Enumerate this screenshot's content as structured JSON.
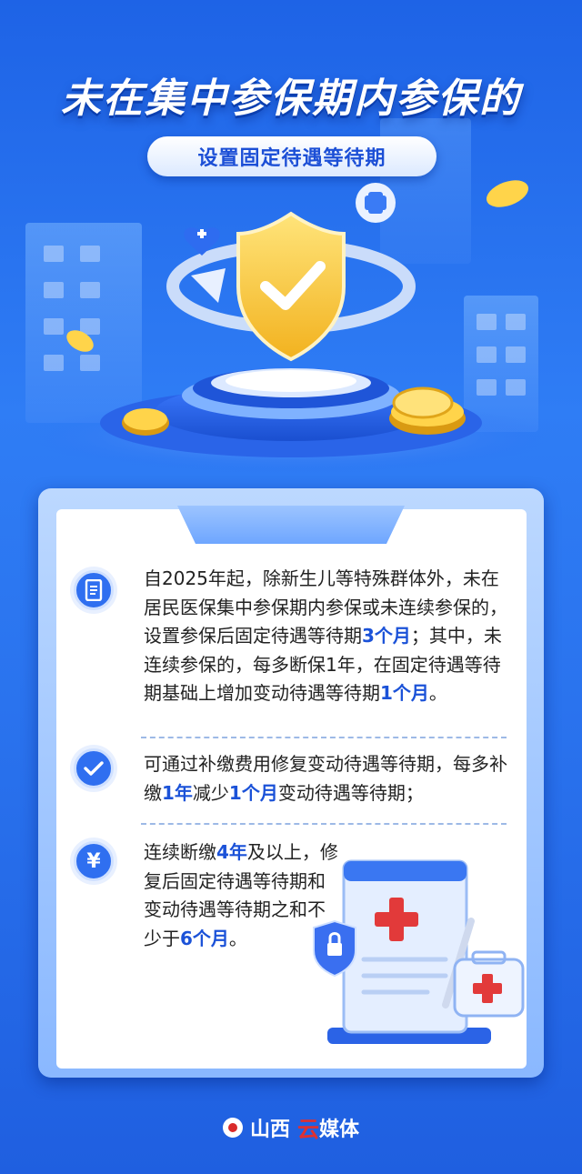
{
  "header": {
    "title": "未在集中参保期内参保的",
    "subtitle": "设置固定待遇等待期"
  },
  "items": [
    {
      "icon": "document-icon",
      "parts": [
        {
          "t": "自2025年起，除新生儿等特殊群体外，未在居民医保集中参保期内参保或未连续参保的，设置参保后固定待遇等待期",
          "hl": false
        },
        {
          "t": "3个月",
          "hl": true
        },
        {
          "t": "；其中，未连续参保的，每多断保1年，在固定待遇等待期基础上增加变动待遇等待期",
          "hl": false
        },
        {
          "t": "1个月",
          "hl": true
        },
        {
          "t": "。",
          "hl": false
        }
      ]
    },
    {
      "icon": "check-circle-icon",
      "parts": [
        {
          "t": "可通过补缴费用修复变动待遇等待期，每多补缴",
          "hl": false
        },
        {
          "t": "1年",
          "hl": true
        },
        {
          "t": "减少",
          "hl": false
        },
        {
          "t": "1个月",
          "hl": true
        },
        {
          "t": "变动待遇等待期；",
          "hl": false
        }
      ]
    },
    {
      "icon": "yen-icon",
      "parts": [
        {
          "t": "连续断缴",
          "hl": false
        },
        {
          "t": "4年",
          "hl": true
        },
        {
          "t": "及以上，修复后固定待遇等待期和变动待遇等待期之和不少于",
          "hl": false
        },
        {
          "t": "6个月",
          "hl": true
        },
        {
          "t": "。",
          "hl": false
        }
      ]
    }
  ],
  "footer": {
    "brand_a": "山西",
    "brand_b": "云",
    "brand_c": "媒体"
  },
  "colors": {
    "accent": "#1b52d8",
    "background": "#2f7df5",
    "gold": "#f6c12c"
  }
}
